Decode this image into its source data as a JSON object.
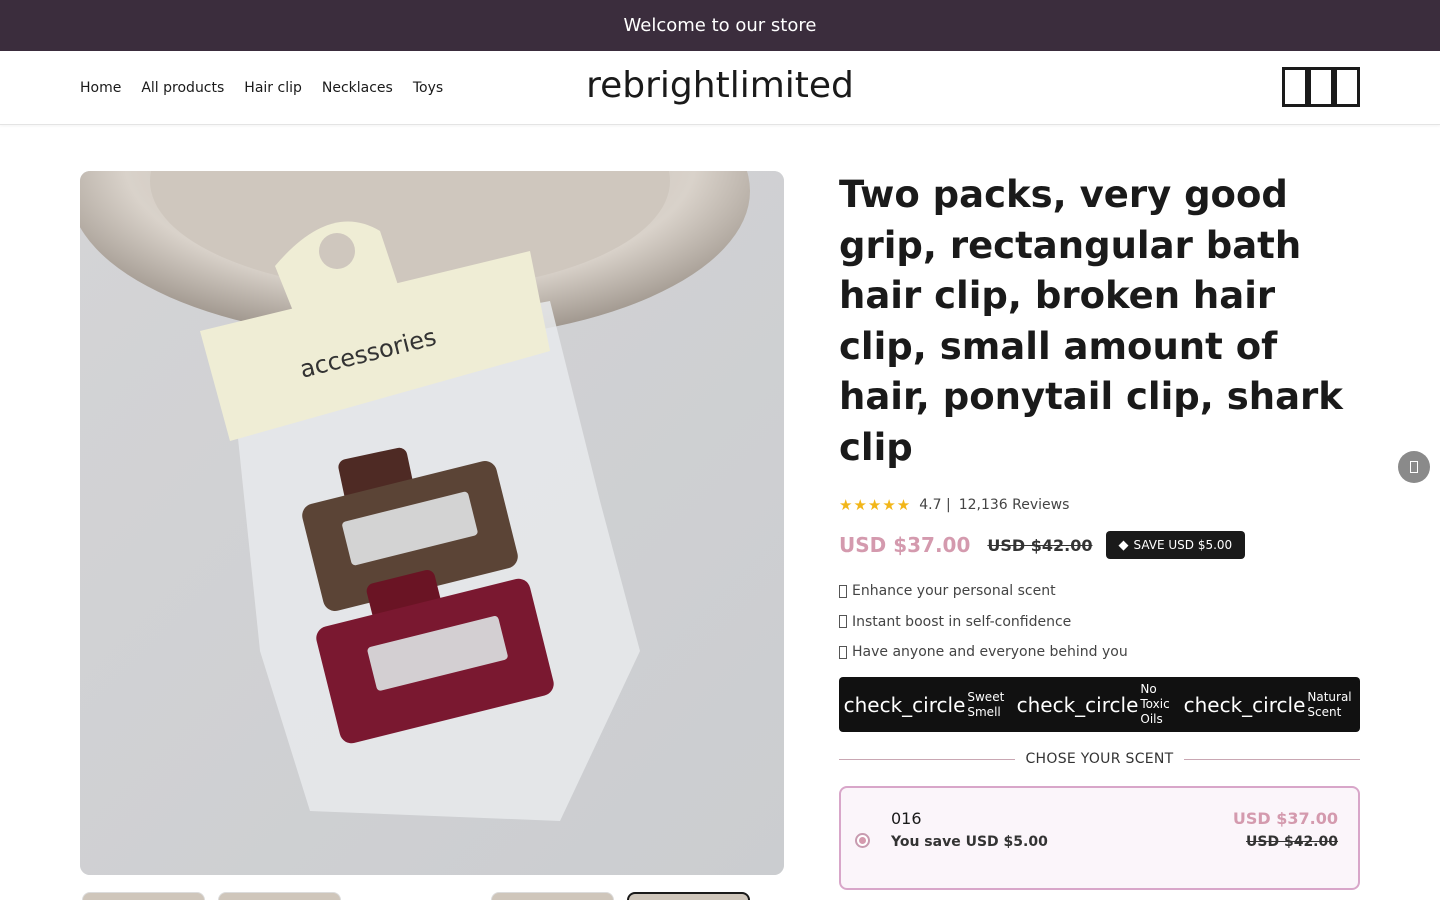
{
  "announcement": "Welcome to our store",
  "nav": {
    "items": [
      "Home",
      "All products",
      "Hair clip",
      "Necklaces",
      "Toys"
    ]
  },
  "logo": "rebrightlimited",
  "header_icons": [
    "search-icon",
    "account-icon",
    "cart-icon"
  ],
  "product": {
    "title": "Two packs, very good grip, rectangular bath hair clip, broken hair clip, small amount of hair, ponytail clip, shark clip",
    "rating": "4.7 |",
    "reviews": "12,136 Reviews",
    "price": "USD $37.00",
    "compare_price": "USD $42.00",
    "save_badge": "SAVE USD $5.00",
    "benefits": [
      "Enhance your personal scent",
      "Instant boost in self-confidence",
      "Have anyone and everyone behind you"
    ],
    "features": [
      {
        "icon": "check_circle",
        "label": "Sweet Smell"
      },
      {
        "icon": "check_circle",
        "label": "No Toxic Oils"
      },
      {
        "icon": "check_circle",
        "label": "Natural Scent"
      }
    ],
    "scent_heading": "CHOSE YOUR SCENT",
    "option": {
      "name": "016",
      "save_text": "You save USD $5.00",
      "price": "USD $37.00",
      "compare_price": "USD $42.00"
    },
    "image_text": "accessories"
  },
  "colors": {
    "announcement_bg": "#3b2d3d",
    "price_accent": "#d49aae",
    "option_border": "#d8a6c9",
    "star": "#f2b619"
  }
}
